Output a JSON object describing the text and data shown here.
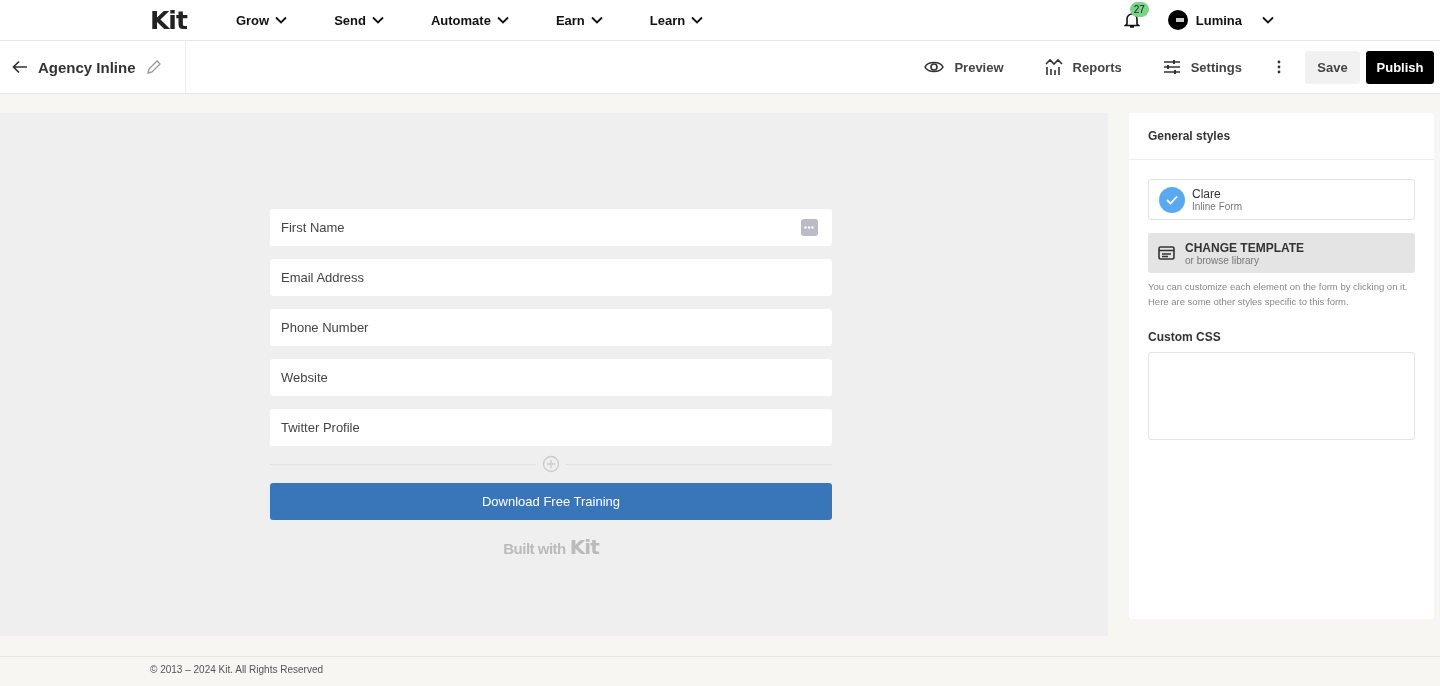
{
  "nav": {
    "logo": "Kit",
    "menu": [
      {
        "label": "Grow"
      },
      {
        "label": "Send"
      },
      {
        "label": "Automate"
      },
      {
        "label": "Earn"
      },
      {
        "label": "Learn"
      }
    ],
    "notifications": "27",
    "account": "Lumina"
  },
  "toolbar": {
    "title": "Agency Inline",
    "actions": [
      {
        "label": "Preview",
        "kind": "preview"
      },
      {
        "label": "Reports",
        "kind": "reports"
      },
      {
        "label": "Settings",
        "kind": "settings"
      }
    ],
    "save": "Save",
    "publish": "Publish"
  },
  "form": {
    "fields": [
      {
        "placeholder": "First Name",
        "autofill_icon": true
      },
      {
        "placeholder": "Email Address",
        "autofill_icon": false
      },
      {
        "placeholder": "Phone Number",
        "autofill_icon": false
      },
      {
        "placeholder": "Website",
        "autofill_icon": false
      },
      {
        "placeholder": "Twitter Profile",
        "autofill_icon": false
      }
    ],
    "button": "Download Free Training",
    "built_with": "Built with",
    "built_logo": "Kit"
  },
  "panel": {
    "title": "General styles",
    "template": {
      "name": "Clare",
      "type": "Inline Form"
    },
    "change": {
      "title": "CHANGE TEMPLATE",
      "subtitle": "or browse library"
    },
    "help": "You can customize each element on the form by clicking on it. Here are some other styles specific to this form.",
    "css_label": "Custom CSS"
  },
  "footer": "© 2013 – 2024 Kit. All Rights Reserved"
}
